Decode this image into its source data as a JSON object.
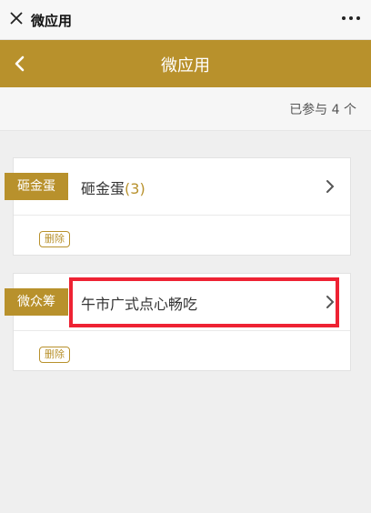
{
  "topbar": {
    "title": "微应用",
    "close_icon": "close-icon",
    "more_icon": "more-icon"
  },
  "header": {
    "title": "微应用",
    "back_icon": "back-icon",
    "color": "#b8912c"
  },
  "count_text": "已参与 4 个",
  "cards": [
    {
      "tag": "砸金蛋",
      "name": "砸金蛋",
      "count": "(3)",
      "delete_label": "删除"
    },
    {
      "tag": "微众筹",
      "name": "午市广式点心畅吃",
      "count": "",
      "delete_label": "删除"
    }
  ],
  "colors": {
    "accent": "#b8912c",
    "highlight": "#ee2233"
  }
}
